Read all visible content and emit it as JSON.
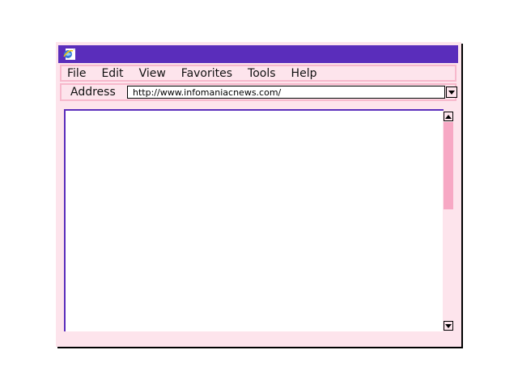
{
  "menubar": {
    "items": [
      "File",
      "Edit",
      "View",
      "Favorites",
      "Tools",
      "Help"
    ]
  },
  "addressbar": {
    "label": "Address",
    "url": "http://www.infomaniacnews.com/"
  },
  "icons": {
    "app": "browser-globe-icon",
    "dropdown": "chevron-down-icon",
    "scroll_up": "arrow-up-icon",
    "scroll_down": "arrow-down-icon"
  },
  "colors": {
    "titlebar": "#5a2dbb",
    "window_bg": "#fde4ec",
    "toolbar_border": "#f7b8cc",
    "scroll_thumb": "#f7a8c4",
    "content_border": "#5a2dbb"
  }
}
